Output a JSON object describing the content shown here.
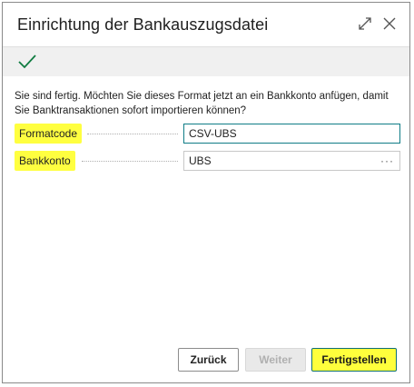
{
  "dialog": {
    "title": "Einrichtung der Bankauszugsdatei",
    "instruction": "Sie sind fertig. Möchten Sie dieses Format jetzt an ein Bankkonto anfügen, damit Sie Banktransaktionen sofort importieren können?"
  },
  "fields": {
    "format_code": {
      "label": "Formatcode",
      "value": "CSV-UBS"
    },
    "bank_account": {
      "label": "Bankkonto",
      "value": "UBS",
      "lookup": "···"
    }
  },
  "buttons": {
    "back": "Zurück",
    "next": "Weiter",
    "finish": "Fertigstellen"
  },
  "colors": {
    "highlight": "#ffff40",
    "accent": "#0f7c86",
    "check": "#107c41"
  }
}
